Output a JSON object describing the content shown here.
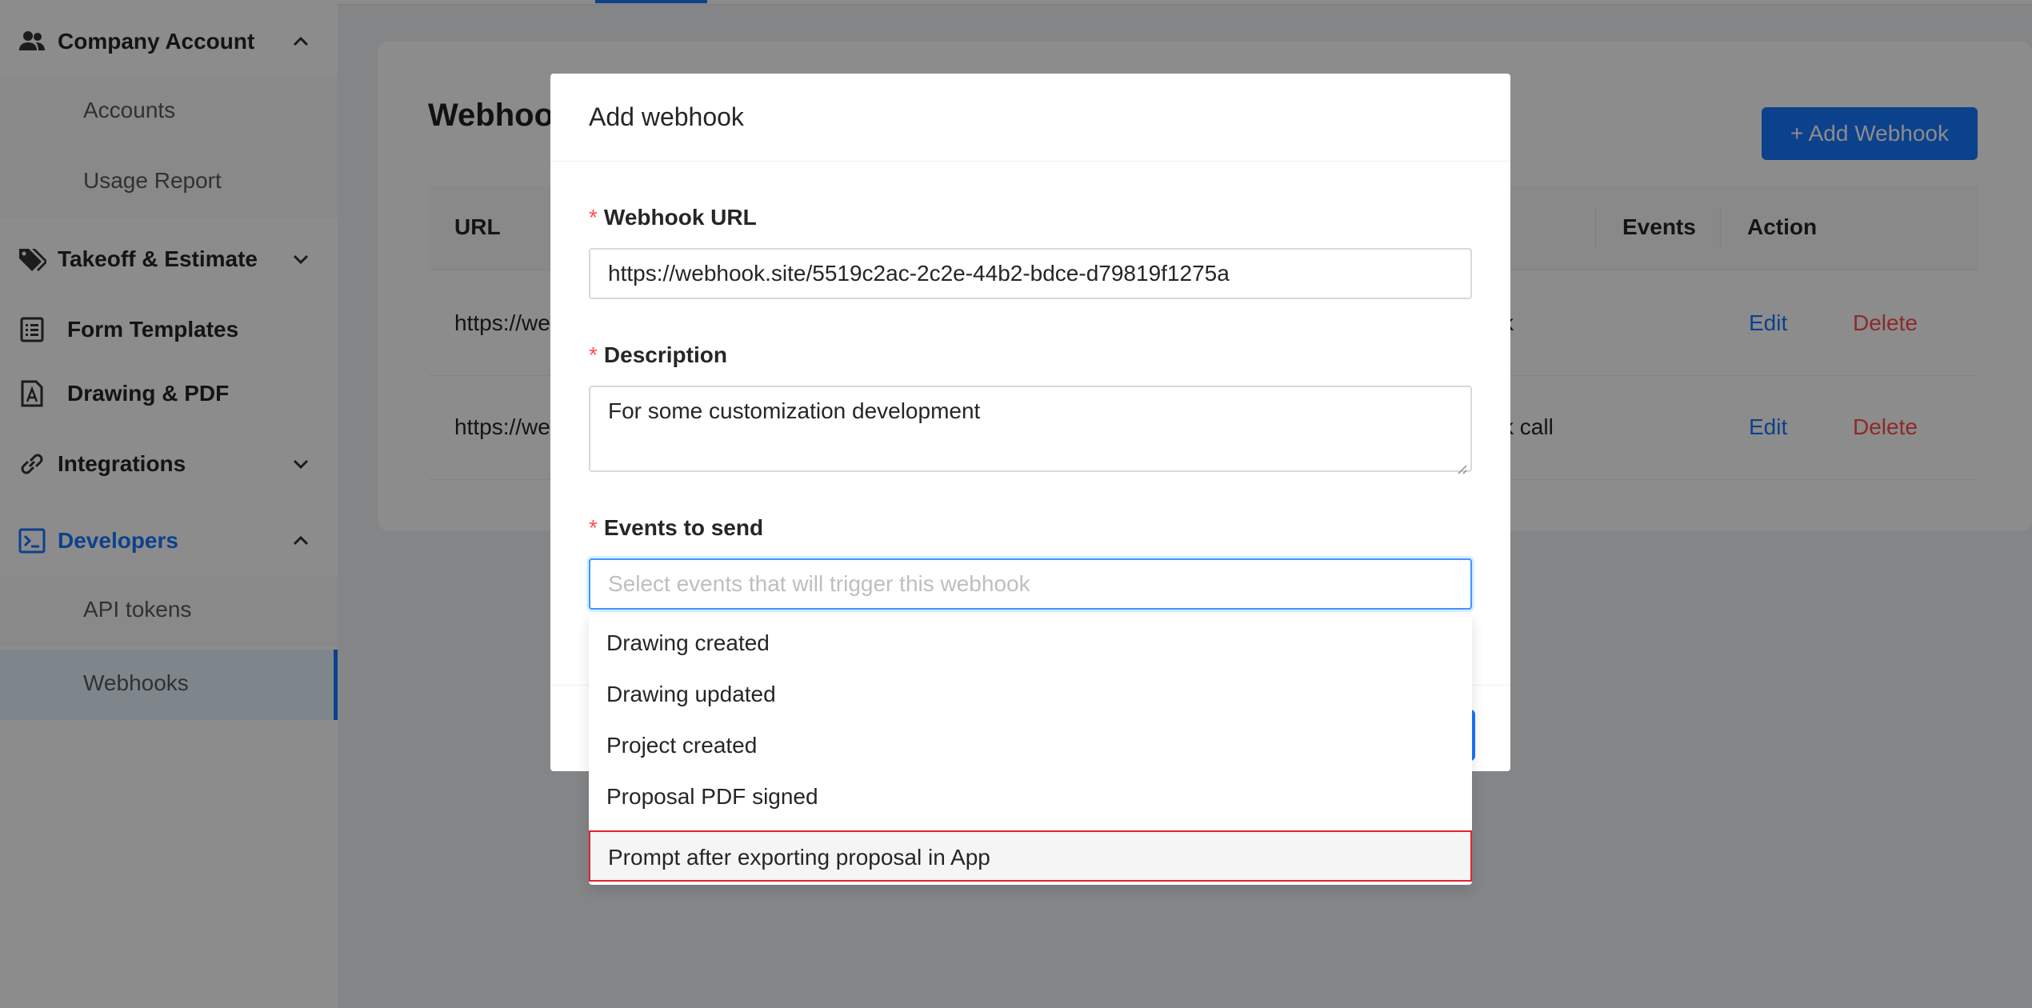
{
  "sidebar": {
    "groups": [
      {
        "label": "Company Account",
        "icon": "users-icon",
        "chevron": "up"
      },
      {
        "label": "Takeoff & Estimate",
        "icon": "tags-icon",
        "chevron": "down"
      },
      {
        "label": "Form Templates",
        "icon": "list-icon"
      },
      {
        "label": "Drawing & PDF",
        "icon": "drawing-file-icon"
      },
      {
        "label": "Integrations",
        "icon": "link-icon",
        "chevron": "down"
      },
      {
        "label": "Developers",
        "icon": "terminal-icon",
        "chevron": "up",
        "active": true
      }
    ],
    "company_items": [
      "Accounts",
      "Usage Report"
    ],
    "developer_items": [
      "API tokens",
      "Webhooks"
    ]
  },
  "page": {
    "title": "Webhooks",
    "add_button": "+ Add Webhook",
    "columns": {
      "url": "URL",
      "events": "Events",
      "action": "Action"
    },
    "rows": [
      {
        "url": "https://we",
        "description": "k",
        "edit": "Edit",
        "delete": "Delete"
      },
      {
        "url": "https://we",
        "description": "k call",
        "edit": "Edit",
        "delete": "Delete"
      }
    ]
  },
  "modal": {
    "title": "Add webhook",
    "required_mark": "*",
    "url_label": "Webhook URL",
    "url_value": "https://webhook.site/5519c2ac-2c2e-44b2-bdce-d79819f1275a",
    "description_label": "Description",
    "description_value": "For some customization development",
    "events_label": "Events to send",
    "events_placeholder": "Select events that will trigger this webhook",
    "options": [
      "Drawing created",
      "Drawing updated",
      "Project created",
      "Proposal PDF signed",
      "Prompt after exporting proposal in App"
    ],
    "highlighted_option": "Prompt after exporting proposal in App"
  },
  "colors": {
    "primary": "#1677ff",
    "danger": "#ff4d4f",
    "highlight_border": "#e0242f"
  }
}
